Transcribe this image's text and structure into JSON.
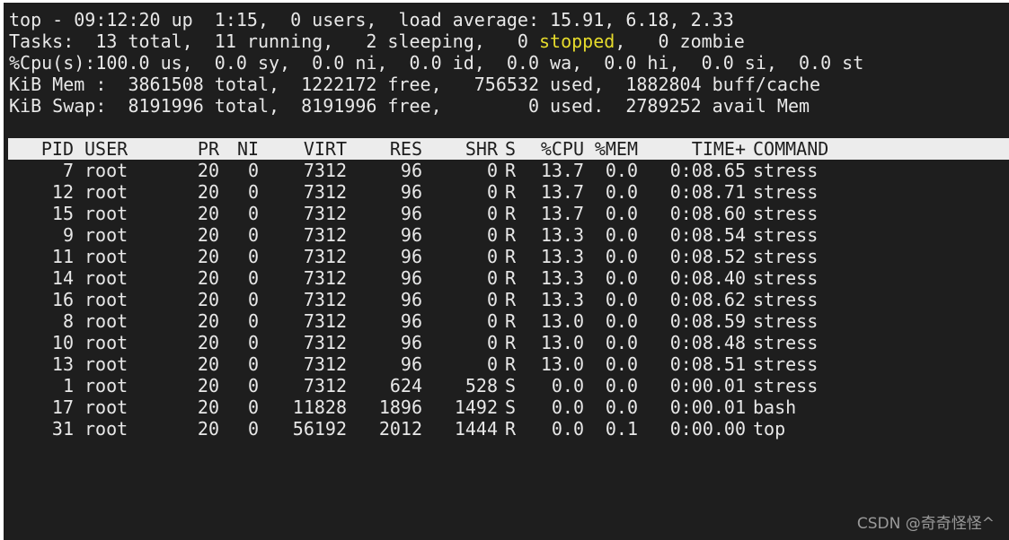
{
  "summary": {
    "line1": "top - 09:12:20 up  1:15,  0 users,  load average: 15.91, 6.18, 2.33",
    "line2_before": "Tasks:  13 total,  11 running,   2 sleeping,   0 ",
    "line2_stopped": "stopped",
    "line2_after": ",   0 zombie",
    "line3": "%Cpu(s):100.0 us,  0.0 sy,  0.0 ni,  0.0 id,  0.0 wa,  0.0 hi,  0.0 si,  0.0 st",
    "line4": "KiB Mem :  3861508 total,  1222172 free,   756532 used,  1882804 buff/cache",
    "line5": "KiB Swap:  8191996 total,  8191996 free,        0 used.  2789252 avail Mem"
  },
  "colors": {
    "terminal_bg": "#1e1e1e",
    "text": "#e8e8e8",
    "stopped_highlight": "#e6db2c",
    "header_bar_bg": "#ececec"
  },
  "columns": {
    "pid": "PID",
    "user": "USER",
    "pr": "PR",
    "ni": "NI",
    "virt": "VIRT",
    "res": "RES",
    "shr": "SHR",
    "s": "S",
    "cpu": "%CPU",
    "mem": "%MEM",
    "time": "TIME+",
    "command": "COMMAND"
  },
  "processes": [
    {
      "pid": "7",
      "user": "root",
      "pr": "20",
      "ni": "0",
      "virt": "7312",
      "res": "96",
      "shr": "0",
      "s": "R",
      "cpu": "13.7",
      "mem": "0.0",
      "time": "0:08.65",
      "command": "stress"
    },
    {
      "pid": "12",
      "user": "root",
      "pr": "20",
      "ni": "0",
      "virt": "7312",
      "res": "96",
      "shr": "0",
      "s": "R",
      "cpu": "13.7",
      "mem": "0.0",
      "time": "0:08.71",
      "command": "stress"
    },
    {
      "pid": "15",
      "user": "root",
      "pr": "20",
      "ni": "0",
      "virt": "7312",
      "res": "96",
      "shr": "0",
      "s": "R",
      "cpu": "13.7",
      "mem": "0.0",
      "time": "0:08.60",
      "command": "stress"
    },
    {
      "pid": "9",
      "user": "root",
      "pr": "20",
      "ni": "0",
      "virt": "7312",
      "res": "96",
      "shr": "0",
      "s": "R",
      "cpu": "13.3",
      "mem": "0.0",
      "time": "0:08.54",
      "command": "stress"
    },
    {
      "pid": "11",
      "user": "root",
      "pr": "20",
      "ni": "0",
      "virt": "7312",
      "res": "96",
      "shr": "0",
      "s": "R",
      "cpu": "13.3",
      "mem": "0.0",
      "time": "0:08.52",
      "command": "stress"
    },
    {
      "pid": "14",
      "user": "root",
      "pr": "20",
      "ni": "0",
      "virt": "7312",
      "res": "96",
      "shr": "0",
      "s": "R",
      "cpu": "13.3",
      "mem": "0.0",
      "time": "0:08.40",
      "command": "stress"
    },
    {
      "pid": "16",
      "user": "root",
      "pr": "20",
      "ni": "0",
      "virt": "7312",
      "res": "96",
      "shr": "0",
      "s": "R",
      "cpu": "13.3",
      "mem": "0.0",
      "time": "0:08.62",
      "command": "stress"
    },
    {
      "pid": "8",
      "user": "root",
      "pr": "20",
      "ni": "0",
      "virt": "7312",
      "res": "96",
      "shr": "0",
      "s": "R",
      "cpu": "13.0",
      "mem": "0.0",
      "time": "0:08.59",
      "command": "stress"
    },
    {
      "pid": "10",
      "user": "root",
      "pr": "20",
      "ni": "0",
      "virt": "7312",
      "res": "96",
      "shr": "0",
      "s": "R",
      "cpu": "13.0",
      "mem": "0.0",
      "time": "0:08.48",
      "command": "stress"
    },
    {
      "pid": "13",
      "user": "root",
      "pr": "20",
      "ni": "0",
      "virt": "7312",
      "res": "96",
      "shr": "0",
      "s": "R",
      "cpu": "13.0",
      "mem": "0.0",
      "time": "0:08.51",
      "command": "stress"
    },
    {
      "pid": "1",
      "user": "root",
      "pr": "20",
      "ni": "0",
      "virt": "7312",
      "res": "624",
      "shr": "528",
      "s": "S",
      "cpu": "0.0",
      "mem": "0.0",
      "time": "0:00.01",
      "command": "stress"
    },
    {
      "pid": "17",
      "user": "root",
      "pr": "20",
      "ni": "0",
      "virt": "11828",
      "res": "1896",
      "shr": "1492",
      "s": "S",
      "cpu": "0.0",
      "mem": "0.0",
      "time": "0:00.01",
      "command": "bash"
    },
    {
      "pid": "31",
      "user": "root",
      "pr": "20",
      "ni": "0",
      "virt": "56192",
      "res": "2012",
      "shr": "1444",
      "s": "R",
      "cpu": "0.0",
      "mem": "0.1",
      "time": "0:00.00",
      "command": "top"
    }
  ],
  "watermark": "CSDN @奇奇怪怪^"
}
